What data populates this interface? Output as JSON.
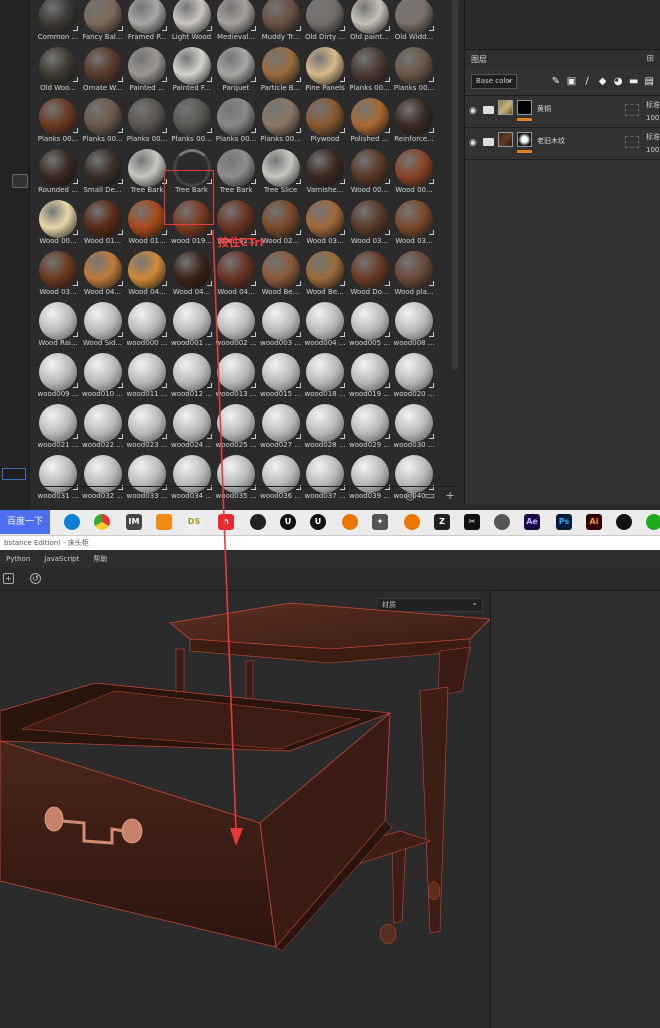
{
  "hint_text": "按住CTrl",
  "materials": [
    [
      "Common ...",
      "Fancy Bal...",
      "Framed P...",
      "Light Wood",
      "Medieval...",
      "Muddy Tr...",
      "Old Dirty ...",
      "Old paint...",
      "Old Widd..."
    ],
    [
      "Old Woo...",
      "Ornate W...",
      "Painted ...",
      "Painted F...",
      "Parquet",
      "Particle B...",
      "Pine Panels",
      "Planks 00...",
      "Planks 00..."
    ],
    [
      "Planks 00...",
      "Planks 00...",
      "Planks 00...",
      "Planks 00...",
      "Planks 00...",
      "Planks 00...",
      "Plywood",
      "Polished ...",
      "Reinforce..."
    ],
    [
      "Rounded ...",
      "Small De...",
      "Tree Bark",
      "Tree Bark",
      "Tree Bark",
      "Tree Slice",
      "Varnishe...",
      "Wood 00...",
      "Wood 00..."
    ],
    [
      "Wood 00...",
      "Wood 01...",
      "Wood 01...",
      "wood 019...",
      "Wood 02...",
      "Wood 02...",
      "Wood 03...",
      "Wood 03...",
      "Wood 03..."
    ],
    [
      "Wood 03...",
      "Wood 04...",
      "Wood 04...",
      "Wood 04...",
      "Wood 04...",
      "Wood Be...",
      "Wood Be...",
      "Wood Do...",
      "Wood pla..."
    ],
    [
      "Wood Rai...",
      "Wood Sid...",
      "wood000 ...",
      "wood001 ...",
      "wood002 ...",
      "wood003 ...",
      "wood004 ...",
      "wood005 ...",
      "wood008 ..."
    ],
    [
      "wood009 ...",
      "wood010 ...",
      "wood011 ...",
      "wood012 ...",
      "wood013 ...",
      "wood015 ...",
      "wood018 ...",
      "wood019 ...",
      "wood020 ..."
    ],
    [
      "wood021 ...",
      "wood022 ...",
      "wood023 ...",
      "wood024 ...",
      "wood025 ...",
      "wood027 ...",
      "wood028 ...",
      "wood029 ...",
      "wood030 ..."
    ],
    [
      "wood031 ...",
      "wood032 ...",
      "wood033 ...",
      "wood034 ...",
      "wood035 ...",
      "wood036 ...",
      "wood037 ...",
      "wood039 ...",
      "wood040 ..."
    ]
  ],
  "layers_panel": {
    "title": "图层",
    "blend_mode": "Base color",
    "layers": [
      {
        "name": "黄铜",
        "opacity_label": "标准",
        "opacity": "100"
      },
      {
        "name": "老旧木纹",
        "opacity_label": "标准",
        "opacity": "100"
      }
    ]
  },
  "taskbar": {
    "search_button": "百度一下",
    "icons": [
      "edge-icon",
      "chrome-icon",
      "im-icon",
      "substance-icon",
      "ds-icon",
      "red-app-icon",
      "circle-app-icon",
      "unreal-icon",
      "unreal-icon-2",
      "blender-icon",
      "star-app-icon",
      "blender-icon-2",
      "zbrush-icon",
      "capcut-icon",
      "cloud-icon",
      "ae-icon",
      "ps-icon",
      "ai-icon",
      "qq-icon",
      "wechat-icon"
    ],
    "icon_labels": {
      "im": "IM",
      "ds": "DS",
      "ae": "Ae",
      "ps": "Ps",
      "ai": "Ai"
    }
  },
  "painter": {
    "window_title": "bstance Edition) - 床头柜",
    "menus": [
      "Python",
      "JavaScript",
      "帮助"
    ],
    "material_dropdown": "材质"
  },
  "colors": {
    "selection_red": "#e53b3b",
    "hint_red": "#ff3b3b",
    "accent_blue": "#4e6ef2",
    "layer_orange": "#e2801a",
    "wire_red": "#c8483a"
  }
}
